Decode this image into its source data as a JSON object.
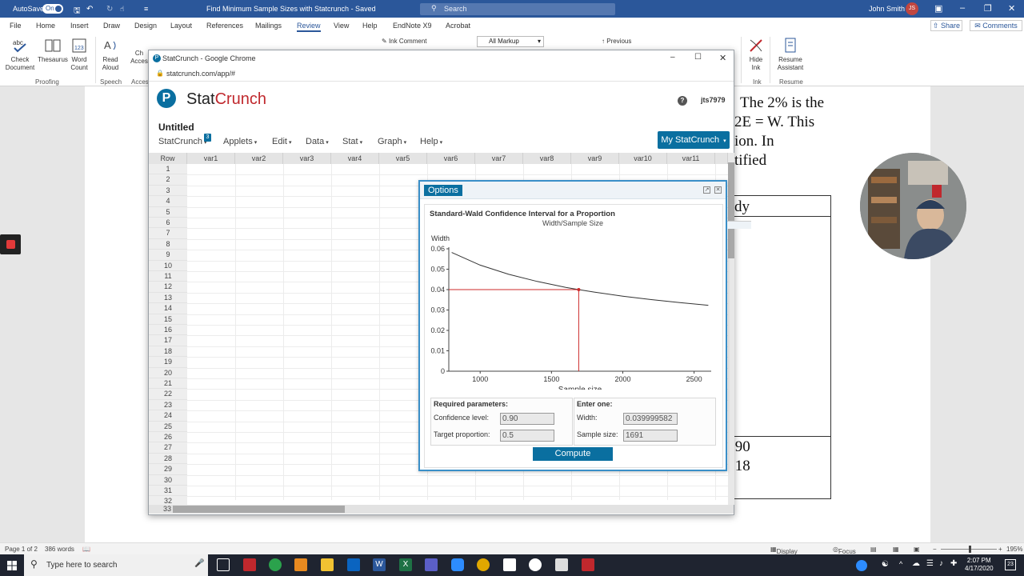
{
  "word": {
    "autosave_label": "AutoSave",
    "autosave_state": "On",
    "doc_title": "Find Minimum Sample Sizes with Statcrunch  -  Saved  ",
    "search_placeholder": "Search",
    "user_name": "John Smith",
    "user_initials": "JS",
    "tabs": [
      "File",
      "Home",
      "Insert",
      "Draw",
      "Design",
      "Layout",
      "References",
      "Mailings",
      "Review",
      "View",
      "Help",
      "EndNote X9",
      "Acrobat"
    ],
    "active_tab": "Review",
    "share_label": "Share",
    "comments_label": "Comments",
    "ribbon": {
      "check_document": "Check\nDocument",
      "thesaurus": "Thesaurus",
      "word_count": "Word\nCount",
      "read_aloud": "Read\nAloud",
      "ch_partial": "Ch",
      "acces_partial": "Acces",
      "ink_comment": "Ink Comment",
      "all_markup": "All Markup",
      "previous": "Previous",
      "hide_ink": "Hide\nInk",
      "resume_assistant": "Resume\nAssistant",
      "groups": {
        "proofing": "Proofing",
        "speech": "Speech",
        "acces": "Acces",
        "ink": "Ink",
        "resume": "Resume"
      }
    },
    "doc_text": {
      "line1": "The 2% is the",
      "line2": "2E = W.  This",
      "line3": "ion.  In",
      "line4": "tified",
      "cell_label": "dy",
      "val1": ".90",
      "val2": ".18"
    },
    "status": {
      "page": "Page 1 of 2",
      "words": "386 words",
      "display_settings": "Display Settings",
      "focus": "Focus",
      "zoom": "195%"
    }
  },
  "taskbar": {
    "search_placeholder": "Type here to search",
    "time": "2:07 PM",
    "date": "4/17/2020",
    "notif_count": "23"
  },
  "chrome": {
    "window_title": "StatCrunch - Google Chrome",
    "url": "statcrunch.com/app/#"
  },
  "statcrunch": {
    "brand_stat": "Stat",
    "brand_crunch": "Crunch",
    "user": "jts7979",
    "doc_name": "Untitled",
    "menu": [
      "StatCrunch",
      "Applets",
      "Edit",
      "Data",
      "Stat",
      "Graph",
      "Help"
    ],
    "badge": "3",
    "my_statcrunch": "My StatCrunch",
    "grid": {
      "row_header": "Row",
      "columns": [
        "var1",
        "var2",
        "var3",
        "var4",
        "var5",
        "var6",
        "var7",
        "var8",
        "var9",
        "var10",
        "var11"
      ],
      "rows": [
        "1",
        "2",
        "3",
        "4",
        "5",
        "6",
        "7",
        "8",
        "9",
        "10",
        "11",
        "12",
        "13",
        "14",
        "15",
        "16",
        "17",
        "18",
        "19",
        "20",
        "21",
        "22",
        "23",
        "24",
        "25",
        "26",
        "27",
        "28",
        "29",
        "30",
        "31",
        "32",
        "33"
      ]
    }
  },
  "options_dialog": {
    "title": "Options",
    "heading": "Standard-Wald Confidence Interval for a Proportion",
    "required_heading": "Required parameters:",
    "confidence_label": "Confidence level:",
    "confidence_value": "0.90",
    "proportion_label": "Target proportion:",
    "proportion_value": "0.5",
    "enter_one_heading": "Enter one:",
    "width_label": "Width:",
    "width_value": "0.039999582",
    "sample_label": "Sample size:",
    "sample_value": "1691",
    "compute_label": "Compute"
  },
  "chart_data": {
    "type": "line",
    "title": "Width/Sample Size",
    "xlabel": "Sample size",
    "ylabel": "Width",
    "xlim": [
      780,
      2620
    ],
    "ylim": [
      0,
      0.06
    ],
    "xticks": [
      1000,
      1500,
      2000,
      2500
    ],
    "yticks": [
      0,
      0.01,
      0.02,
      0.03,
      0.04,
      0.05,
      0.06
    ],
    "series": [
      {
        "x": [
          800,
          1000,
          1200,
          1400,
          1600,
          1691,
          1800,
          2000,
          2200,
          2400,
          2600
        ],
        "values": [
          0.0582,
          0.052,
          0.0475,
          0.044,
          0.0411,
          0.04,
          0.0388,
          0.0368,
          0.0351,
          0.0336,
          0.0323
        ],
        "color": "#333333"
      }
    ],
    "marker": {
      "x": 1691,
      "y": 0.04,
      "color": "#cc2a2a"
    },
    "grid": false
  }
}
